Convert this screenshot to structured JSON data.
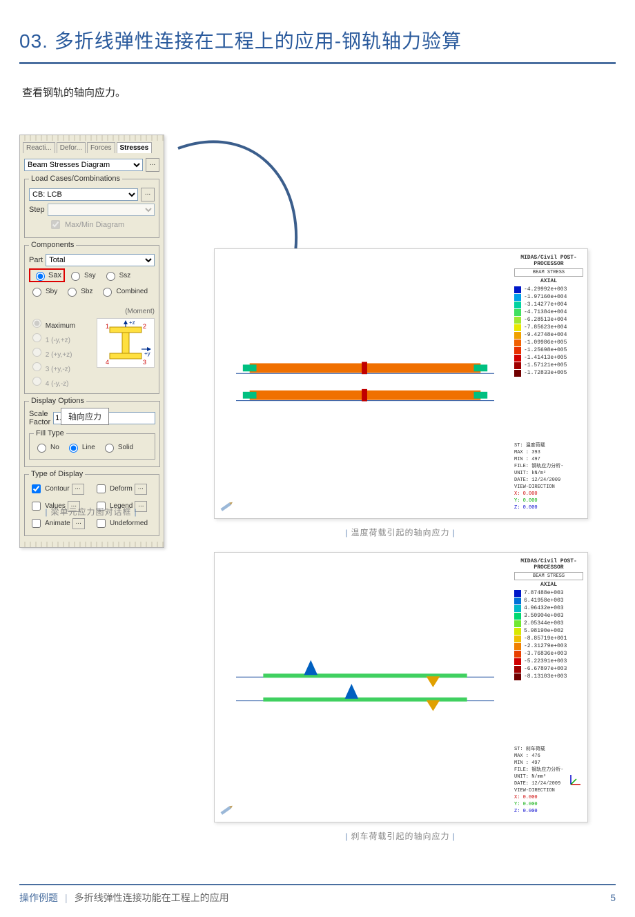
{
  "header": {
    "title": "03. 多折线弹性连接在工程上的应用-钢轨轴力验算"
  },
  "intro": "查看钢轨的轴向应力。",
  "dialog": {
    "tabs": [
      "Reacti...",
      "Defor...",
      "Forces",
      "Stresses"
    ],
    "active_tab": 3,
    "main_select": "Beam Stresses Diagram",
    "load_group": {
      "legend": "Load Cases/Combinations",
      "combo_value": "CB: LCB",
      "step_label": "Step",
      "step_value": "",
      "maxmin_label": "Max/Min Diagram"
    },
    "components": {
      "legend": "Components",
      "part_label": "Part",
      "part_value": "Total",
      "radios_row1": [
        "Sax",
        "Ssy",
        "Ssz"
      ],
      "radios_row2": [
        "Sby",
        "Sbz",
        "Combined"
      ],
      "tooltip": "轴向应力",
      "section_label": "(Moment)",
      "section_opts": [
        "Maximum",
        "1 (-y,+z)",
        "2 (+y,+z)",
        "3 (+y,-z)",
        "4 (-y,-z)"
      ],
      "corners": [
        "1",
        "2",
        "3",
        "4"
      ],
      "axes": [
        "+z",
        "+y"
      ]
    },
    "display": {
      "legend": "Display Options",
      "scale_label": "Scale Factor",
      "scale_value": "1.000000",
      "fill_legend": "Fill Type",
      "fill_opts": [
        "No",
        "Line",
        "Solid"
      ],
      "fill_selected": 1
    },
    "tod": {
      "legend": "Type of Display",
      "items": [
        {
          "label": "Contour",
          "btn": true,
          "checked": true
        },
        {
          "label": "Deform",
          "btn": true,
          "checked": false
        },
        {
          "label": "Values",
          "btn": true,
          "checked": false
        },
        {
          "label": "Legend",
          "btn": true,
          "checked": false
        },
        {
          "label": "Animate",
          "btn": true,
          "checked": false
        },
        {
          "label": "Undeformed",
          "btn": false,
          "checked": false
        }
      ]
    },
    "caption": "梁单元应力图对话框"
  },
  "result1": {
    "legend_header": "MIDAS/Civil POST-PROCESSOR",
    "legend_section": "BEAM STRESS",
    "legend_kind": "AXIAL",
    "legend": [
      {
        "c": "#0018c8",
        "v": "-4.29992e+003"
      },
      {
        "c": "#00a0e8",
        "v": "-1.97160e+004"
      },
      {
        "c": "#00d2a0",
        "v": "-3.14277e+004"
      },
      {
        "c": "#40e060",
        "v": "-4.71384e+004"
      },
      {
        "c": "#a0e830",
        "v": "-6.28513e+004"
      },
      {
        "c": "#e8e800",
        "v": "-7.85623e+004"
      },
      {
        "c": "#f0a000",
        "v": "-9.42748e+004"
      },
      {
        "c": "#f06000",
        "v": "-1.09986e+005"
      },
      {
        "c": "#e83000",
        "v": "-1.25698e+005"
      },
      {
        "c": "#d00000",
        "v": "-1.41413e+005"
      },
      {
        "c": "#a00000",
        "v": "-1.57121e+005"
      },
      {
        "c": "#700000",
        "v": "-1.72833e+005"
      }
    ],
    "info": {
      "st": "ST: 温度荷载",
      "max": "MAX : 393",
      "min": "MIN : 497",
      "file": "FILE: 钢轨应力分析-",
      "unit": "UNIT: kN/m²",
      "date": "DATE: 12/24/2009",
      "view": "VIEW-DIRECTION",
      "x": "X: 0.000",
      "y": "Y: 0.000",
      "z": "Z: 0.000"
    },
    "caption": "温度荷载引起的轴向应力"
  },
  "result2": {
    "legend_header": "MIDAS/Civil POST-PROCESSOR",
    "legend_section": "BEAM STRESS",
    "legend_kind": "AXIAL",
    "legend": [
      {
        "c": "#0018c8",
        "v": "7.87488e+003"
      },
      {
        "c": "#0070d8",
        "v": "6.41958e+003"
      },
      {
        "c": "#00b8c8",
        "v": "4.96432e+003"
      },
      {
        "c": "#00d870",
        "v": "3.50904e+003"
      },
      {
        "c": "#70e830",
        "v": "2.05344e+003"
      },
      {
        "c": "#d8e800",
        "v": "5.98190e+002"
      },
      {
        "c": "#f0c000",
        "v": "-8.85719e+001"
      },
      {
        "c": "#f08000",
        "v": "-2.31279e+003"
      },
      {
        "c": "#e84000",
        "v": "-3.76836e+003"
      },
      {
        "c": "#d00000",
        "v": "-5.22391e+003"
      },
      {
        "c": "#a00000",
        "v": "-6.67897e+003"
      },
      {
        "c": "#700000",
        "v": "-8.13103e+003"
      }
    ],
    "info": {
      "st": "ST: 刹车荷载",
      "max": "MAX : 476",
      "min": "MIN : 497",
      "file": "FILE: 钢轨应力分析-",
      "unit": "UNIT: N/mm²",
      "date": "DATE: 12/24/2009",
      "view": "VIEW-DIRECTION",
      "x": "X: 0.000",
      "y": "Y: 0.000",
      "z": "Z: 0.000"
    },
    "caption": "刹车荷载引起的轴向应力"
  },
  "footer": {
    "left1": "操作例题",
    "left2": "多折线弹性连接功能在工程上的应用",
    "page": "5"
  }
}
